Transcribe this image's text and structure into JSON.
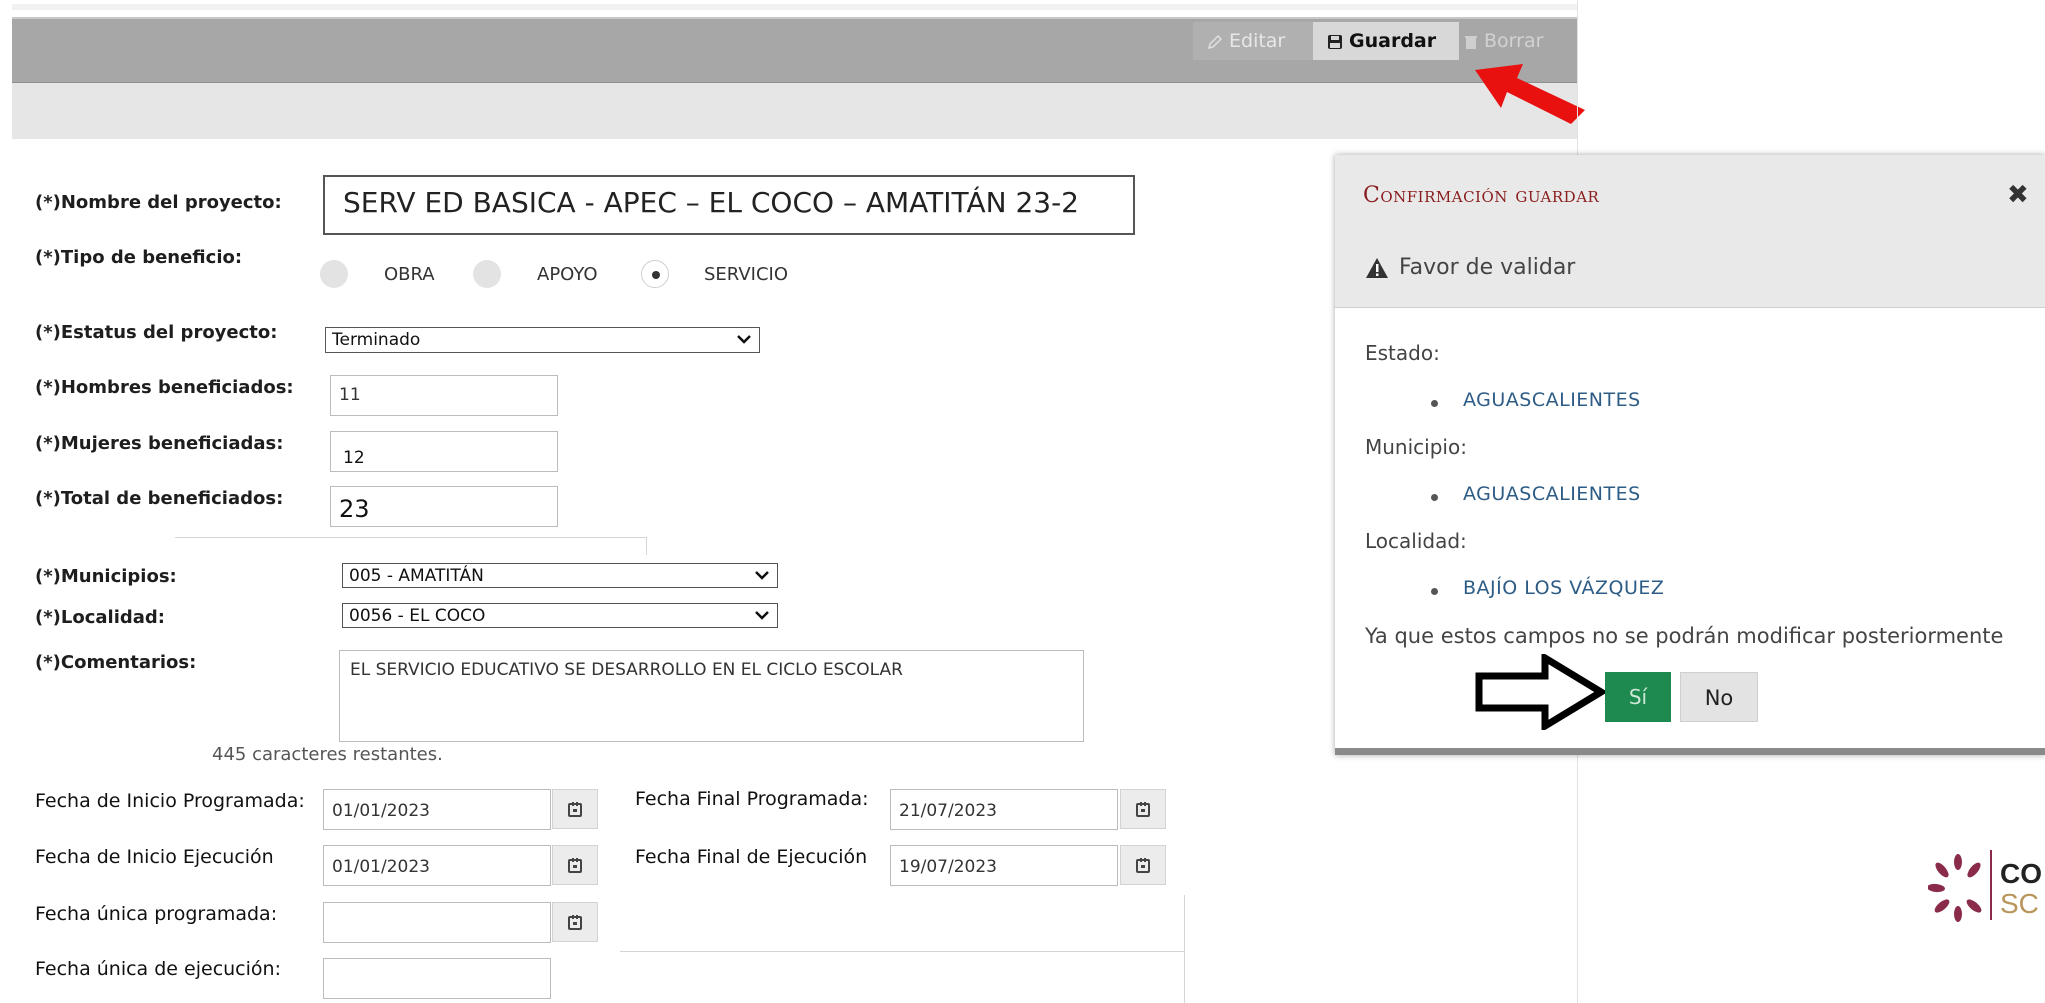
{
  "toolbar": {
    "editar_label": "Editar",
    "guardar_label": "Guardar",
    "borrar_label": "Borrar"
  },
  "form": {
    "nombre_label": "(*)Nombre del proyecto:",
    "nombre_value": "SERV ED BASICA - APEC – EL COCO – AMATITÁN 23-2",
    "tipo_label": "(*)Tipo de beneficio:",
    "tipo_options": [
      "OBRA",
      "APOYO",
      "SERVICIO"
    ],
    "tipo_selected": "SERVICIO",
    "estatus_label": "(*)Estatus del proyecto:",
    "estatus_value": "Terminado",
    "hombres_label": "(*)Hombres beneficiados:",
    "hombres_value": "11",
    "mujeres_label": "(*)Mujeres beneficiadas:",
    "mujeres_value": "12",
    "total_label": "(*)Total de beneficiados:",
    "total_value": "23",
    "municipios_label": "(*)Municipios:",
    "municipios_value": "005 - AMATITÁN",
    "localidad_label": "(*)Localidad:",
    "localidad_value": "0056 - EL COCO",
    "comentarios_label": "(*)Comentarios:",
    "comentarios_value": "EL SERVICIO EDUCATIVO SE DESARROLLO EN EL CICLO ESCOLAR",
    "remaining_text": "445 caracteres restantes.",
    "fecha_inicio_prog_label": "Fecha de Inicio Programada:",
    "fecha_inicio_prog_value": "01/01/2023",
    "fecha_final_prog_label": "Fecha Final Programada:",
    "fecha_final_prog_value": "21/07/2023",
    "fecha_inicio_ejec_label": "Fecha de Inicio Ejecución",
    "fecha_inicio_ejec_value": "01/01/2023",
    "fecha_final_ejec_label": "Fecha Final de Ejecución",
    "fecha_final_ejec_value": "19/07/2023",
    "fecha_unica_prog_label": "Fecha única programada:",
    "fecha_unica_prog_value": "",
    "fecha_unica_ejec_label": "Fecha única de ejecución:",
    "fecha_unica_ejec_value": ""
  },
  "dialog": {
    "title": "Confirmación guardar",
    "note": "Favor de validar",
    "estado_label": "Estado:",
    "estado_value": "AGUASCALIENTES",
    "municipio_label": "Municipio:",
    "municipio_value": "AGUASCALIENTES",
    "localidad_label": "Localidad:",
    "localidad_value": "BAJÍO LOS VÁZQUEZ",
    "warning": "Ya que estos campos no se podrán modificar posteriormente",
    "si_label": "Sí",
    "no_label": "No"
  },
  "logo": {
    "text_line1": "CO",
    "text_line2": "SC"
  },
  "colors": {
    "toolbar": "#a7a7a7",
    "dialog_title": "#8a1d1d",
    "value_blue": "#2d5c86",
    "si_button": "#1e8a4f",
    "arrow_red": "#e8110f",
    "logo": "#8b2b4a"
  },
  "icons": {
    "editar": "pencil-icon",
    "guardar": "floppy-icon",
    "borrar": "trash-icon",
    "calendar": "calendar-icon",
    "warning": "warning-icon",
    "close": "close-icon"
  }
}
